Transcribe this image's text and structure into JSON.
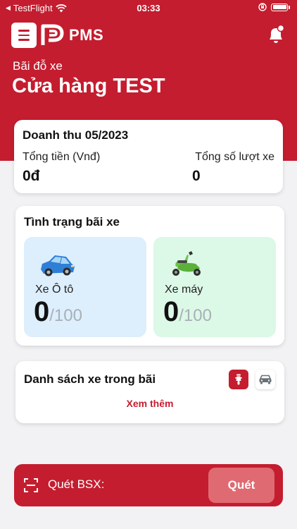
{
  "status_bar": {
    "back_app": "TestFlight",
    "time": "03:33"
  },
  "header": {
    "brand": "PMS",
    "icons": [
      "menu-icon",
      "pms-logo-icon",
      "bell-icon"
    ]
  },
  "parking": {
    "label": "Bãi đỗ xe",
    "store_name": "Cửa hàng TEST"
  },
  "revenue": {
    "title": "Doanh thu 05/2023",
    "total_money_label": "Tổng tiền (Vnđ)",
    "total_money_value": "0đ",
    "total_visits_label": "Tổng số lượt xe",
    "total_visits_value": "0"
  },
  "parking_status": {
    "title": "Tình trạng bãi xe",
    "car": {
      "label": "Xe Ô tô",
      "count": "0",
      "capacity": "/100",
      "icon": "car-icon"
    },
    "motorbike": {
      "label": "Xe máy",
      "count": "0",
      "capacity": "/100",
      "icon": "scooter-icon"
    }
  },
  "vehicle_list": {
    "title": "Danh sách xe trong bãi",
    "more": "Xem thêm",
    "filters": [
      "motorbike-filter-icon",
      "car-filter-icon"
    ]
  },
  "scan": {
    "label": "Quét BSX:",
    "button": "Quét",
    "icon": "scan-icon"
  },
  "colors": {
    "primary": "#c41d2f",
    "car_tile": "#ddeefd",
    "moto_tile": "#dcf8e6"
  }
}
